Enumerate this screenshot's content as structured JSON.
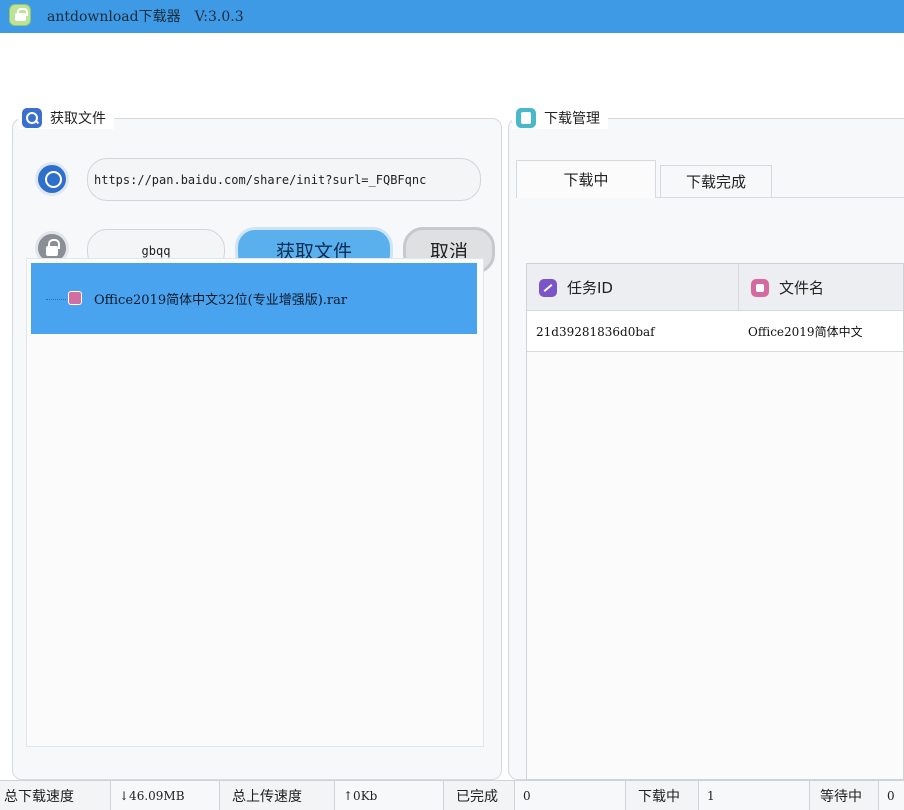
{
  "window": {
    "title": "antdownload下载器",
    "version": "V:3.0.3"
  },
  "fetch_panel": {
    "title": "获取文件",
    "url_value": "https://pan.baidu.com/share/init?surl=_FQBFqnc",
    "code_value": "gbqq",
    "fetch_button": "获取文件",
    "cancel_button": "取消",
    "files": [
      {
        "name": "Office2019简体中文32位(专业增强版).rar",
        "selected": true
      }
    ]
  },
  "download_panel": {
    "title": "下载管理",
    "tabs": [
      {
        "label": "下载中",
        "active": true
      },
      {
        "label": "下载完成",
        "active": false
      }
    ],
    "columns": [
      "任务ID",
      "文件名"
    ],
    "rows": [
      {
        "task_id": "21d39281836d0baf",
        "file_name": "Office2019简体中文"
      }
    ]
  },
  "status_bar": {
    "download_speed_label": "总下载速度",
    "download_speed_value": "↓46.09MB",
    "upload_speed_label": "总上传速度",
    "upload_speed_value": "↑0Kb",
    "completed_label": "已完成",
    "completed_value": "0",
    "downloading_label": "下载中",
    "downloading_value": "1",
    "waiting_label": "等待中",
    "waiting_value": "0"
  },
  "colors": {
    "titlebar": "#3f9ae6",
    "selection": "#4aa3ee",
    "primary_button": "#5ab0ec"
  },
  "icons": [
    "app-icon",
    "search-icon",
    "link-icon",
    "lock-icon",
    "file-icon",
    "clipboard-icon",
    "id-icon",
    "file-name-icon"
  ]
}
